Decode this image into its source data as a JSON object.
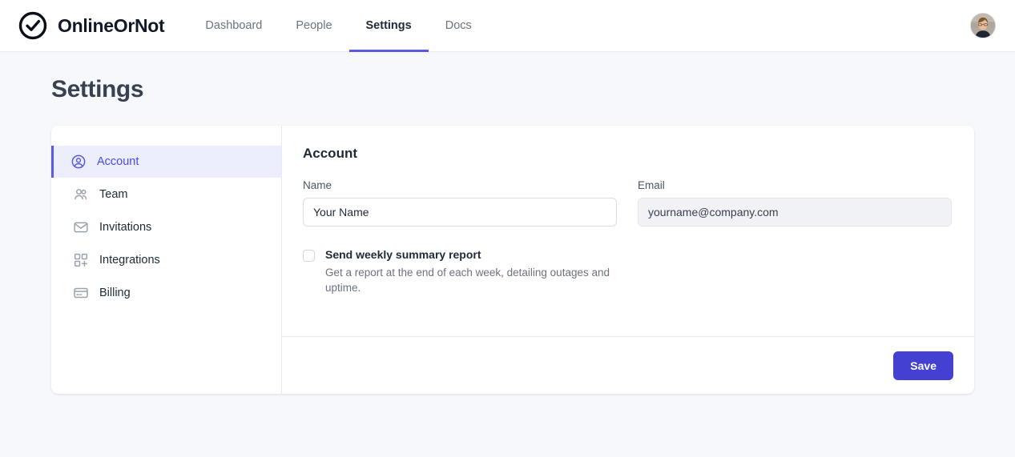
{
  "header": {
    "brand": {
      "name": "OnlineOrNot",
      "logo_icon": "check-circle-icon"
    },
    "nav": [
      {
        "label": "Dashboard",
        "active": false
      },
      {
        "label": "People",
        "active": false
      },
      {
        "label": "Settings",
        "active": true
      },
      {
        "label": "Docs",
        "active": false
      }
    ],
    "avatar_name": "user-avatar"
  },
  "page": {
    "title": "Settings"
  },
  "sidebar": {
    "items": [
      {
        "label": "Account",
        "icon": "user-circle-icon",
        "active": true
      },
      {
        "label": "Team",
        "icon": "users-icon",
        "active": false
      },
      {
        "label": "Invitations",
        "icon": "envelope-icon",
        "active": false
      },
      {
        "label": "Integrations",
        "icon": "grid-plus-icon",
        "active": false
      },
      {
        "label": "Billing",
        "icon": "credit-card-icon",
        "active": false
      }
    ]
  },
  "panel": {
    "title": "Account",
    "name_field": {
      "label": "Name",
      "value": "Your Name",
      "placeholder": "Your Name"
    },
    "email_field": {
      "label": "Email",
      "value": "yourname@company.com",
      "placeholder": "yourname@company.com",
      "readonly": true
    },
    "weekly_report": {
      "checked": false,
      "title": "Send weekly summary report",
      "description": "Get a report at the end of each week, detailing outages and uptime."
    },
    "save_label": "Save"
  },
  "colors": {
    "accent": "#4340d2",
    "accent_light": "#5a5ae0",
    "active_bg": "#eceefd",
    "page_bg": "#f7f8fb",
    "text_muted": "#6b7280"
  }
}
